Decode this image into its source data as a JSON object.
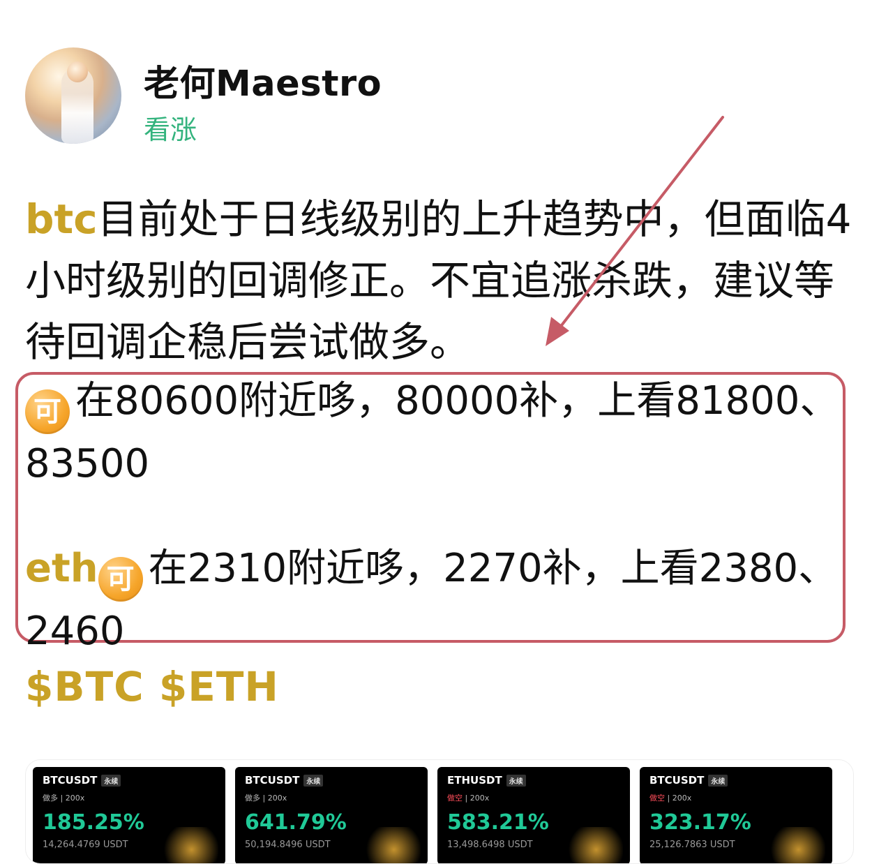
{
  "profile": {
    "name": "老何Maestro",
    "sentiment": "看涨"
  },
  "post": {
    "intro_token": "btc",
    "intro_text": "目前处于日线级别的上升趋势中，但面临4 小时级别的回调修正。不宜追涨杀跌，建议等待回调企稳后尝试做多。",
    "badge_text": "可",
    "btc_line_text": "在80600附近哆，80000补，上看81800、83500",
    "eth_token": "eth",
    "eth_line_text": "在2310附近哆，2270补，上看2380、2460",
    "hashtags": "$BTC $ETH"
  },
  "colors": {
    "accent_gold": "#c9a227",
    "bullish_green": "#33b37d",
    "highlight_box": "#c65b66",
    "badge_orange": "#f6a52a"
  },
  "cards": [
    {
      "pair": "BTCUSDT",
      "contract": "永续",
      "direction": "做多",
      "leverage": "200x",
      "pct": "185.25%",
      "usdt": "14,264.4769 USDT"
    },
    {
      "pair": "BTCUSDT",
      "contract": "永续",
      "direction": "做多",
      "leverage": "200x",
      "pct": "641.79%",
      "usdt": "50,194.8496 USDT"
    },
    {
      "pair": "ETHUSDT",
      "contract": "永续",
      "direction": "做空",
      "leverage": "200x",
      "pct": "583.21%",
      "usdt": "13,498.6498 USDT"
    },
    {
      "pair": "BTCUSDT",
      "contract": "永续",
      "direction": "做空",
      "leverage": "200x",
      "pct": "323.17%",
      "usdt": "25,126.7863 USDT"
    }
  ],
  "icons": {
    "avatar": "avatar-icon",
    "badge": "coin-badge-icon",
    "annotation_arrow": "annotation-arrow-icon"
  }
}
